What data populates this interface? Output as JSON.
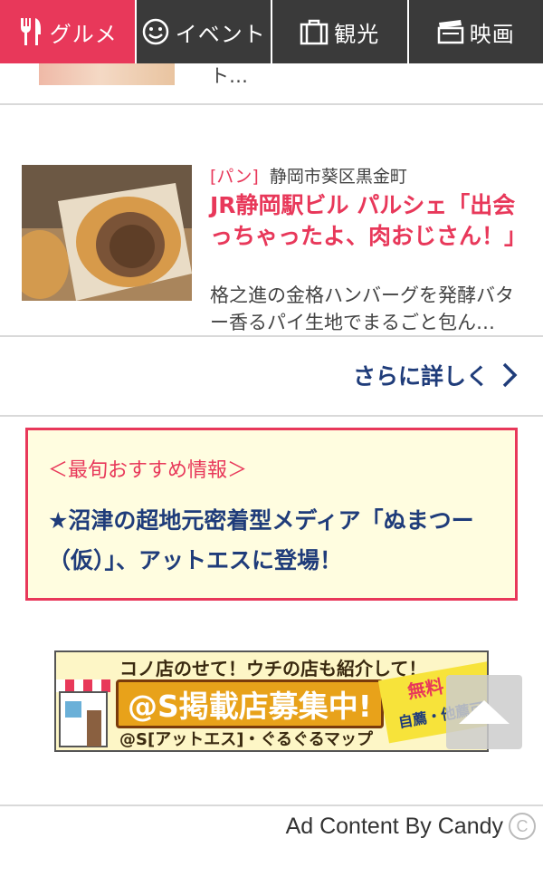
{
  "tabs": [
    {
      "label": "グルメ",
      "icon": "fork-knife-icon",
      "active": true
    },
    {
      "label": "イベント",
      "icon": "smiley-icon",
      "active": false
    },
    {
      "label": "観光",
      "icon": "suitcase-icon",
      "active": false
    },
    {
      "label": "映画",
      "icon": "clapperboard-icon",
      "active": false
    }
  ],
  "prev_article": {
    "fragment": "ト…"
  },
  "article": {
    "category": "[パン]",
    "location": "静岡市葵区黒金町",
    "title": "JR静岡駅ビル パルシェ「出会っちゃったよ、肉おじさん！」",
    "description": "格之進の金格ハンバーグを発酵バター香るパイ生地でまるごと包ん…"
  },
  "more": {
    "label": "さらに詳しく",
    "icon": "chevron-right-icon"
  },
  "recommend": {
    "heading": "＜最旬おすすめ情報＞",
    "body": "★沼津の超地元密着型メディア「ぬまつー（仮）」、アットエスに登場！"
  },
  "banner": {
    "top": "コノ店のせて！ウチの店も紹介して！",
    "main": "@S掲載店募集中!",
    "sub": "@S[アットエス]・ぐるぐるマップ",
    "badge_free": "無料",
    "badge_sub": "自薦・他薦可"
  },
  "footer": {
    "credit": "Ad Content By Candy",
    "icon": "c-logo-icon"
  },
  "colors": {
    "accent": "#e8385a",
    "navy": "#1f3c7a",
    "tab_dark": "#3a3a3a",
    "recommend_bg": "#fffde0"
  }
}
